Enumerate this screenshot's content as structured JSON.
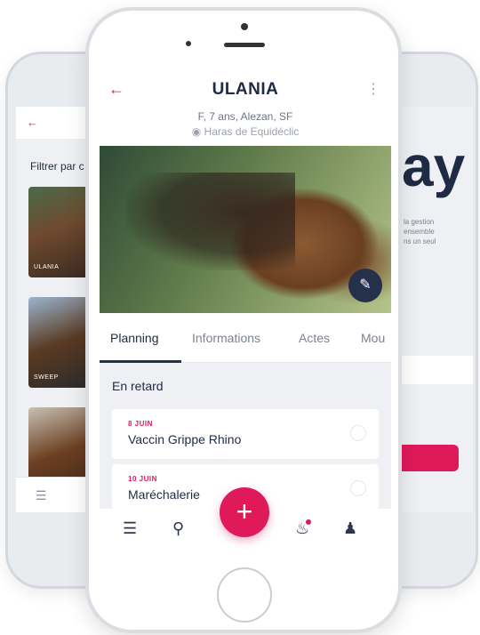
{
  "left_screen": {
    "back_icon": "arrow-left-icon",
    "filter_label": "Filtrer par c",
    "thumbs": [
      {
        "label": "ULANIA"
      },
      {
        "label": "SWEEP"
      },
      {
        "label": ""
      }
    ],
    "menu_icon": "menu-icon"
  },
  "right_screen": {
    "logo_text": "ay",
    "description": "la gestion\nensemble\nns un seul"
  },
  "header": {
    "back_icon": "arrow-left-icon",
    "title": "ULANIA",
    "more_icon": "more-vertical-icon",
    "subtitle": "F, 7 ans, Alezan, SF",
    "location": "Haras de Equidéclic"
  },
  "photo": {
    "edit_icon": "edit-photo-icon"
  },
  "tabs": [
    {
      "label": "Planning",
      "active": true
    },
    {
      "label": "Informations",
      "active": false
    },
    {
      "label": "Actes",
      "active": false
    },
    {
      "label": "Mou",
      "active": false
    }
  ],
  "section": {
    "title": "En retard"
  },
  "cards": [
    {
      "date": "8 JUIN",
      "label": "Vaccin Grippe Rhino"
    },
    {
      "date": "10 JUIN",
      "label": "Maréchalerie"
    }
  ],
  "bottom_nav": {
    "menu_icon": "menu-icon",
    "search_icon": "search-icon",
    "add_icon": "plus-icon",
    "bell_icon": "bell-icon",
    "users_icon": "users-icon"
  },
  "colors": {
    "accent": "#e0195a",
    "navy": "#25304a",
    "background": "#eef0f3"
  }
}
